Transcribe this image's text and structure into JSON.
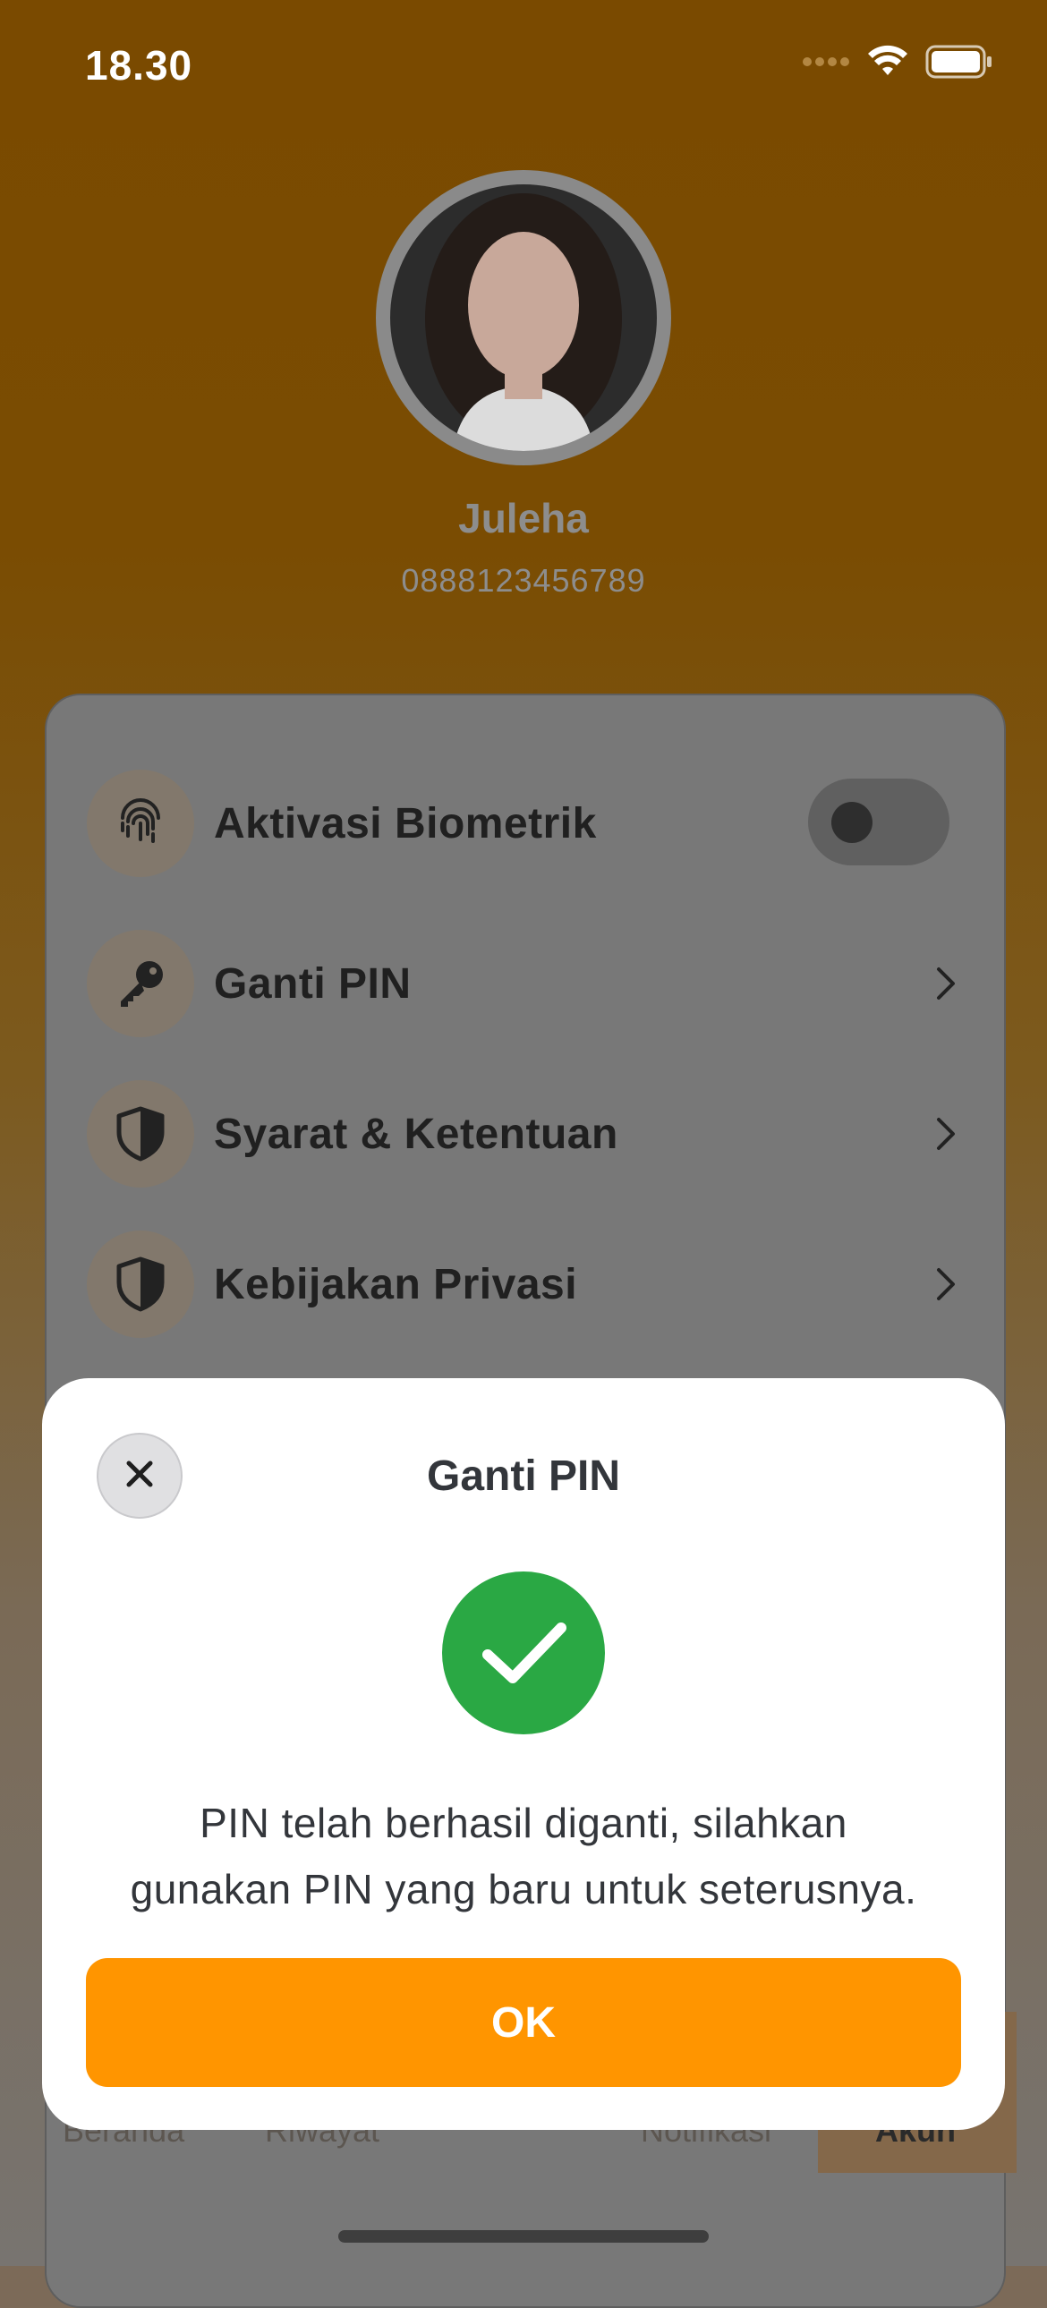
{
  "status_bar": {
    "time": "18.30"
  },
  "profile": {
    "name": "Juleha",
    "phone": "0888123456789"
  },
  "menu": {
    "items": [
      {
        "label": "Aktivasi Biometrik",
        "icon": "fingerprint-icon",
        "control": "toggle",
        "toggle_on": false
      },
      {
        "label": "Ganti PIN",
        "icon": "key-icon",
        "control": "chevron"
      },
      {
        "label": "Syarat & Ketentuan",
        "icon": "shield-icon",
        "control": "chevron"
      },
      {
        "label": "Kebijakan Privasi",
        "icon": "shield-icon",
        "control": "chevron"
      }
    ]
  },
  "tabbar": {
    "tabs": [
      "Beranda",
      "Riwayat",
      "Notifikasi",
      "Akun"
    ],
    "active": "Akun"
  },
  "sheet": {
    "title": "Ganti PIN",
    "message_line1": "PIN telah berhasil diganti, silahkan",
    "message_line2": "gunakan PIN yang baru untuk seterusnya.",
    "ok_label": "OK"
  },
  "colors": {
    "accent": "#ff9500",
    "success": "#2aa844",
    "header_bg": "#7a4a00"
  }
}
